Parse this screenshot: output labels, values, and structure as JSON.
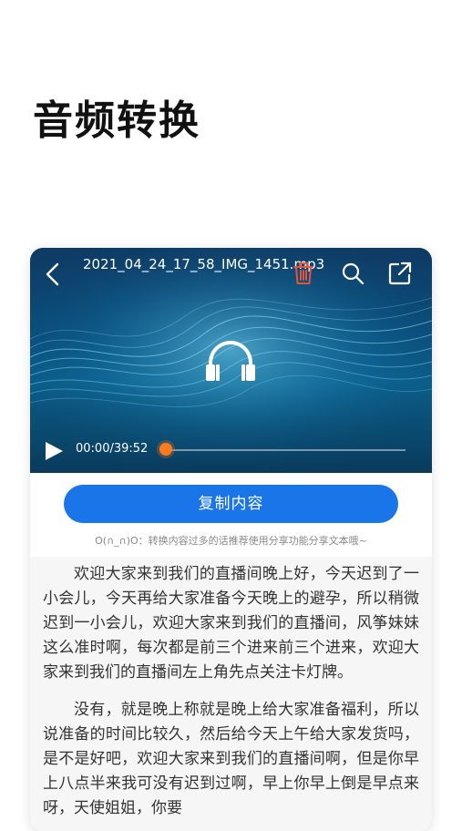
{
  "page": {
    "title": "音频转换"
  },
  "player": {
    "file_name": "2021_04_24_17_58_IMG_1451.mp3",
    "time": "00:00/39:52",
    "progress": 0,
    "icons": {
      "back": "chevron-left-icon",
      "delete": "trash-icon",
      "search": "search-icon",
      "share": "share-icon",
      "center": "headphones-icon",
      "play": "play-icon"
    },
    "colors": {
      "accent": "#ff7a1a",
      "delete": "#e0553c"
    }
  },
  "actions": {
    "copy_label": "复制内容",
    "hint": "O(∩_∩)O：转换内容过多的话推荐使用分享功能分享文本哦~",
    "button_color": "#1a76e8"
  },
  "transcript": {
    "paragraphs": [
      "欢迎大家来到我们的直播间晚上好，今天迟到了一小会儿，今天再给大家准备今天晚上的避孕，所以稍微迟到一小会儿，欢迎大家来到我们的直播间，风筝妹妹这么准时啊，每次都是前三个进来前三个进来，欢迎大家来到我们的直播间左上角先点关注卡灯牌。",
      "没有，就是晚上称就是晚上给大家准备福利，所以说准备的时间比较久，然后给今天上午给大家发货吗，是不是好吧，欢迎大家来到我们的直播间啊，但是你早上八点半来我可没有迟到过啊，早上你早上倒是早点来呀，天使姐姐，你要"
    ]
  }
}
